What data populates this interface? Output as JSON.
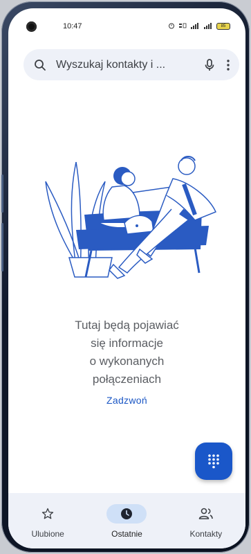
{
  "status_bar": {
    "time": "10:47",
    "battery": "85"
  },
  "search": {
    "placeholder": "Wyszukaj kontakty i ..."
  },
  "empty_state": {
    "lines": [
      "Tutaj będą pojawiać",
      "się informacje",
      "o wykonanych",
      "połączeniach"
    ],
    "action": "Zadzwoń"
  },
  "fab": {
    "icon": "dialpad-icon"
  },
  "bottom_nav": {
    "items": [
      {
        "label": "Ulubione",
        "icon": "star-icon",
        "active": false
      },
      {
        "label": "Ostatnie",
        "icon": "clock-icon",
        "active": true
      },
      {
        "label": "Kontakty",
        "icon": "people-icon",
        "active": false
      }
    ]
  },
  "colors": {
    "accent": "#1a57c9",
    "nav_background": "#eef1f8",
    "active_pill": "#cfe0f7"
  }
}
